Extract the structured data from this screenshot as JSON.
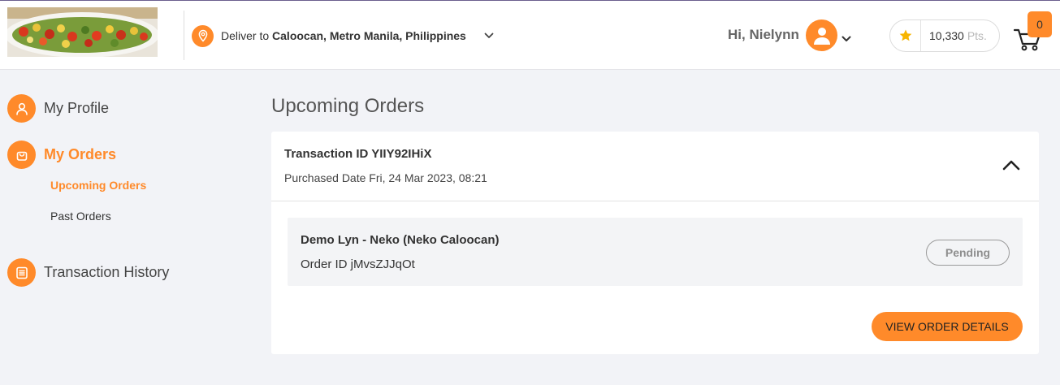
{
  "header": {
    "deliver_prefix": "Deliver to",
    "deliver_location": "Caloocan, Metro Manila, Philippines",
    "greeting": "Hi, Nielynn",
    "points_value": "10,330",
    "points_unit": "Pts.",
    "cart_count": "0"
  },
  "sidebar": {
    "my_profile": "My Profile",
    "my_orders": "My Orders",
    "upcoming_orders": "Upcoming Orders",
    "past_orders": "Past Orders",
    "transaction_history": "Transaction History"
  },
  "main": {
    "title": "Upcoming Orders",
    "transaction": {
      "id_label": "Transaction ID YIIY92IHiX",
      "purchased": "Purchased Date Fri, 24 Mar 2023, 08:21",
      "store": "Demo Lyn - Neko (Neko Caloocan)",
      "order_id": "Order ID jMvsZJJqOt",
      "status": "Pending",
      "view_button": "VIEW ORDER DETAILS"
    }
  },
  "colors": {
    "accent": "#ff8a2a",
    "page_bg": "#f2f3f7",
    "card_bg": "#ffffff"
  }
}
